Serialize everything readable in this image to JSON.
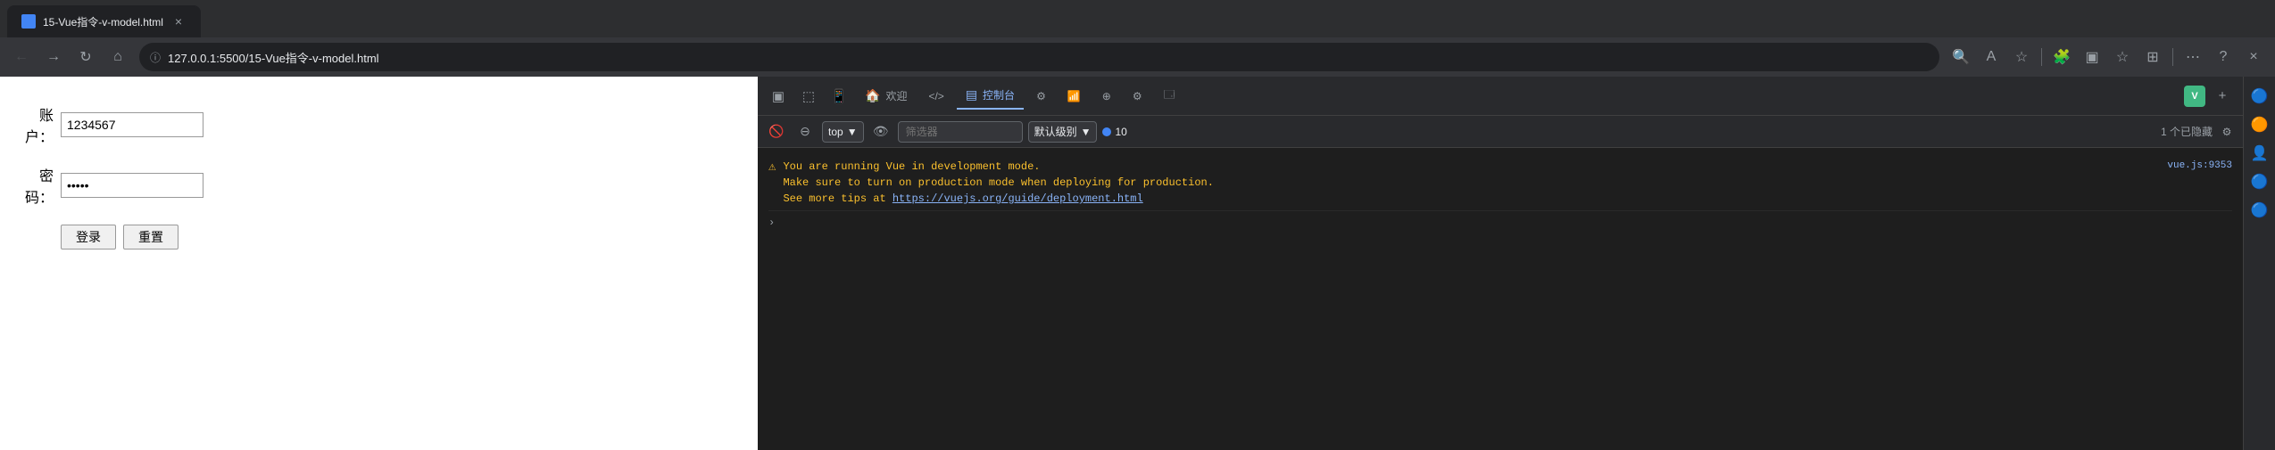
{
  "browser": {
    "tab_title": "15-Vue指令-v-model.html",
    "address": "127.0.0.1:5500/15-Vue指令-v-model.html",
    "protocol_icon": "ⓘ"
  },
  "page": {
    "account_label": "账户：",
    "account_value": "1234567",
    "password_label": "密码：",
    "password_placeholder": "••••",
    "login_btn": "登录",
    "reset_btn": "重置"
  },
  "devtools": {
    "tabs": [
      {
        "label": "欢迎",
        "icon": "🏠"
      },
      {
        "label": "</>",
        "icon": ""
      },
      {
        "label": "控制台",
        "icon": "▤",
        "active": true
      },
      {
        "label": "",
        "icon": "⚙"
      },
      {
        "label": "",
        "icon": "📶"
      },
      {
        "label": "",
        "icon": "⊕"
      },
      {
        "label": "",
        "icon": "⚙"
      },
      {
        "label": "",
        "icon": "🗔"
      }
    ],
    "console": {
      "top_level": "top",
      "filter_placeholder": "筛选器",
      "level_label": "默认级别",
      "message_count": "10",
      "hidden_count": "1 个已隐藏",
      "message_text_line1": "You are running Vue in development mode.",
      "message_text_line2": "Make sure to turn on production mode when deploying for production.",
      "message_text_line3": "See more tips at ",
      "message_link": "https://vuejs.org/guide/deployment.html",
      "message_source": "vue.js:9353"
    }
  }
}
